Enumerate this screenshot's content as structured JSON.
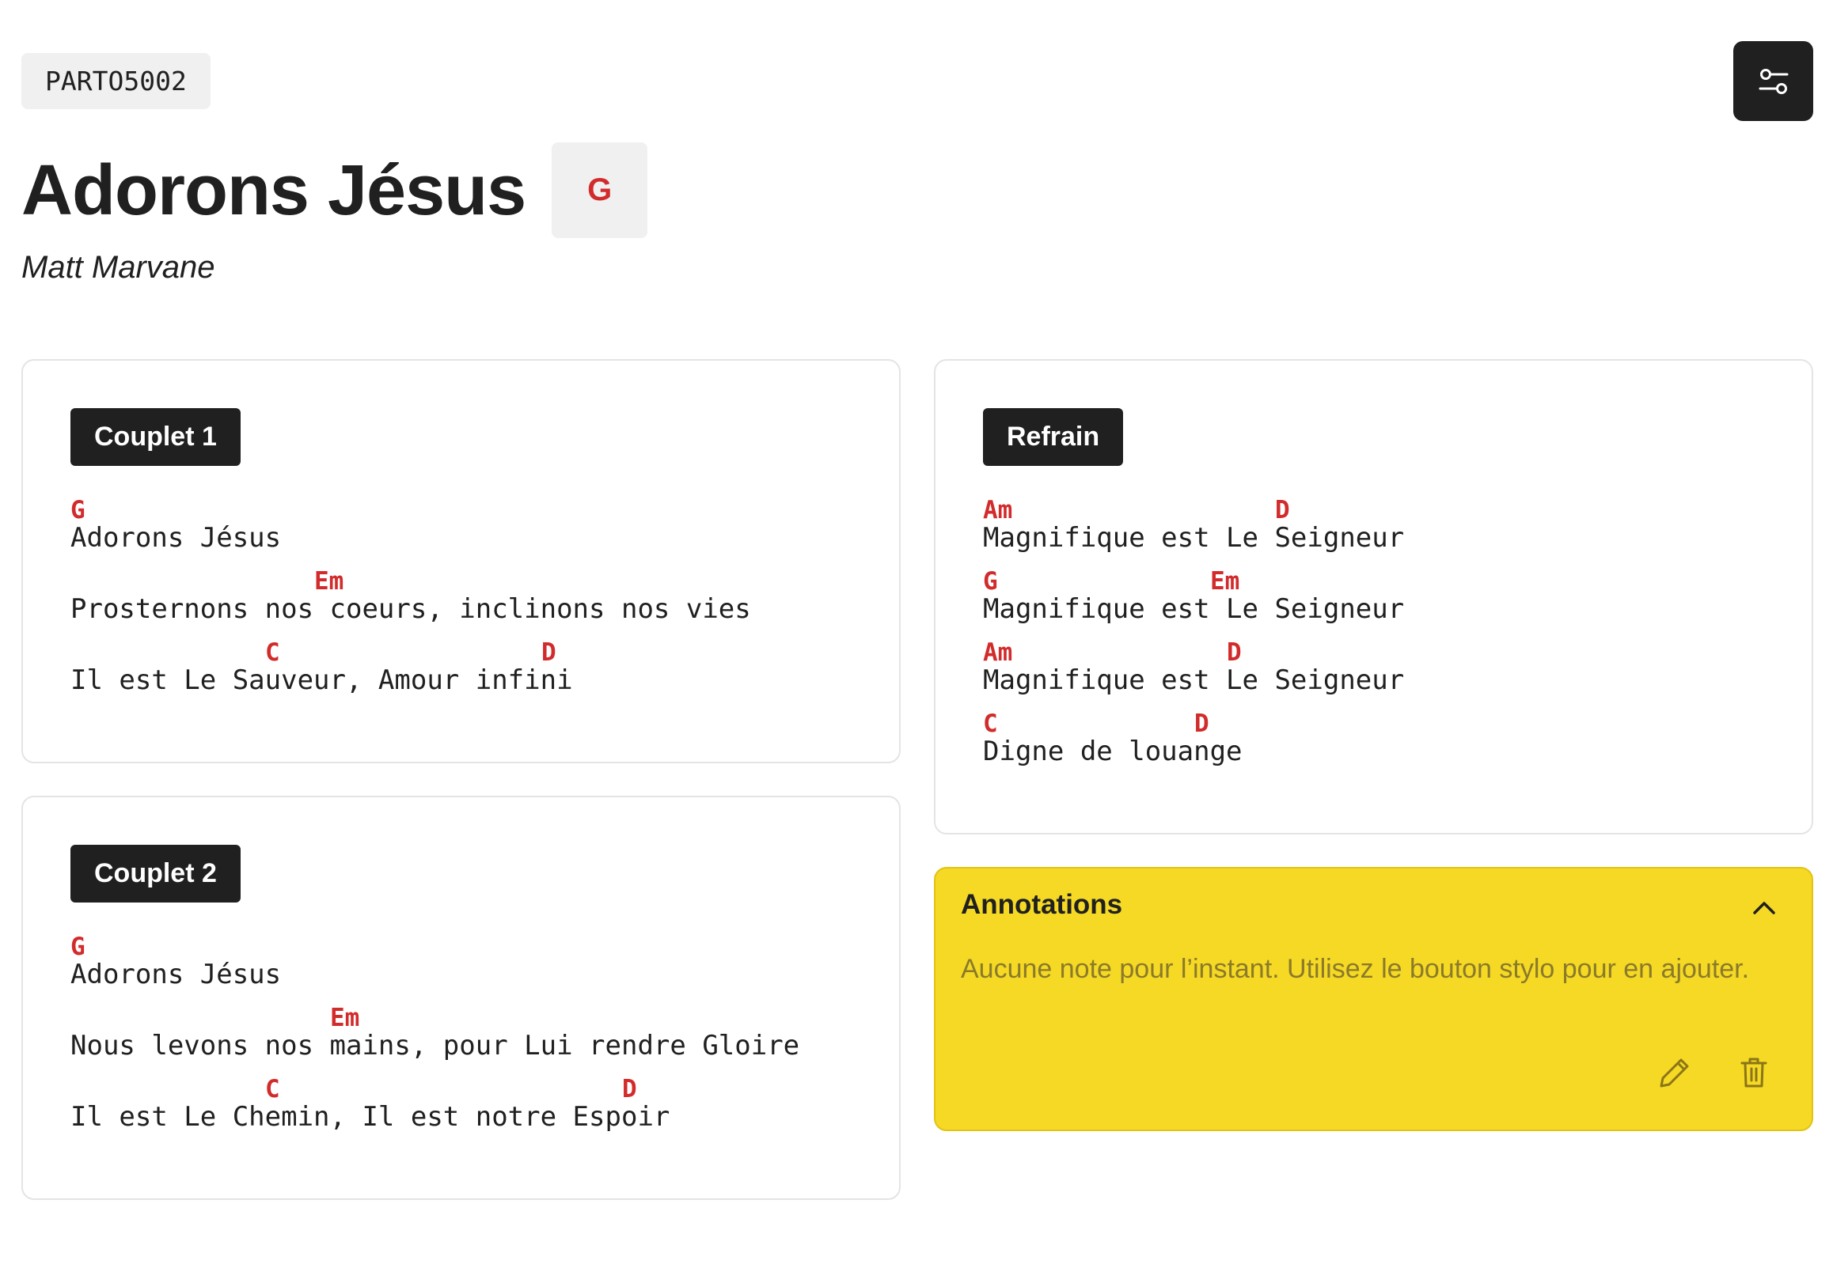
{
  "header": {
    "code": "PARTO5002",
    "title": "Adorons Jésus",
    "key": "G",
    "author": "Matt Marvane",
    "settings_icon": "sliders-icon"
  },
  "colors": {
    "chord": "#d22b2b",
    "label_bg": "#202020",
    "annotation_bg": "#f5d924",
    "card_border": "#e4e4e4"
  },
  "sections": [
    {
      "label": "Couplet 1",
      "lines": [
        {
          "lyric": "Adorons Jésus",
          "chords": [
            {
              "pos": 0,
              "name": "G"
            }
          ]
        },
        {
          "lyric": "Prosternons nos coeurs, inclinons nos vies",
          "chords": [
            {
              "pos": 15,
              "name": "Em"
            }
          ]
        },
        {
          "lyric": "Il est Le Sauveur, Amour infini",
          "chords": [
            {
              "pos": 12,
              "name": "C"
            },
            {
              "pos": 29,
              "name": "D"
            }
          ]
        }
      ]
    },
    {
      "label": "Couplet 2",
      "lines": [
        {
          "lyric": "Adorons Jésus",
          "chords": [
            {
              "pos": 0,
              "name": "G"
            }
          ]
        },
        {
          "lyric": "Nous levons nos mains, pour Lui rendre Gloire",
          "chords": [
            {
              "pos": 16,
              "name": "Em"
            }
          ]
        },
        {
          "lyric": "Il est Le Chemin, Il est notre Espoir",
          "chords": [
            {
              "pos": 12,
              "name": "C"
            },
            {
              "pos": 34,
              "name": "D"
            }
          ]
        }
      ]
    },
    {
      "label": "Refrain",
      "lines": [
        {
          "lyric": "Magnifique est Le Seigneur",
          "chords": [
            {
              "pos": 0,
              "name": "Am"
            },
            {
              "pos": 18,
              "name": "D"
            }
          ]
        },
        {
          "lyric": "Magnifique est Le Seigneur",
          "chords": [
            {
              "pos": 0,
              "name": "G"
            },
            {
              "pos": 14,
              "name": "Em"
            }
          ]
        },
        {
          "lyric": "Magnifique est Le Seigneur",
          "chords": [
            {
              "pos": 0,
              "name": "Am"
            },
            {
              "pos": 15,
              "name": "D"
            }
          ]
        },
        {
          "lyric": "Digne de louange",
          "chords": [
            {
              "pos": 0,
              "name": "C"
            },
            {
              "pos": 13,
              "name": "D"
            }
          ]
        }
      ]
    }
  ],
  "annotations": {
    "title": "Annotations",
    "empty_text": "Aucune note pour l’instant. Utilisez le bouton stylo pour en ajouter.",
    "toggle_icon": "chevron-up-icon",
    "edit_icon": "pencil-icon",
    "delete_icon": "trash-icon"
  }
}
